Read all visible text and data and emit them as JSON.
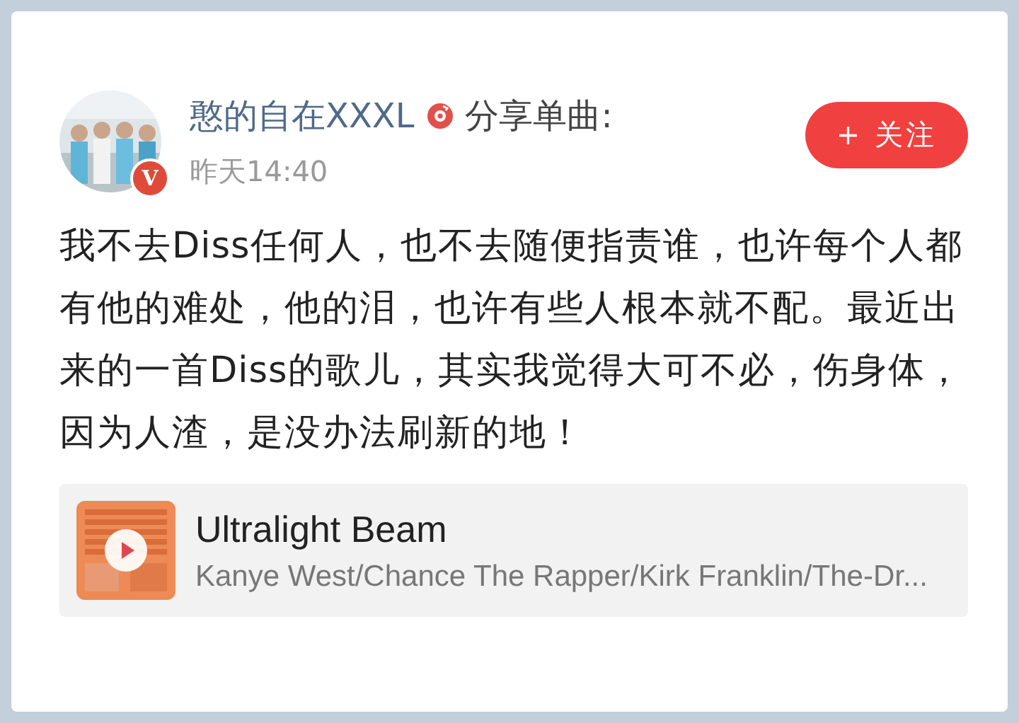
{
  "post": {
    "author": "憨的自在XXXL",
    "verified_badge": "V",
    "action": "分享单曲:",
    "time": "昨天14:40",
    "follow_button": "+ 关注",
    "body": "我不去Diss任何人，也不去随便指责谁，也许每个人都有他的难处，他的泪，也许有些人根本就不配。最近出来的一首Diss的歌儿，其实我觉得大可不必，伤身体，因为人渣，是没办法刷新的地！",
    "song": {
      "title": "Ultralight Beam",
      "artists": "Kanye West/Chance The Rapper/Kirk Franklin/The-Dr..."
    }
  }
}
